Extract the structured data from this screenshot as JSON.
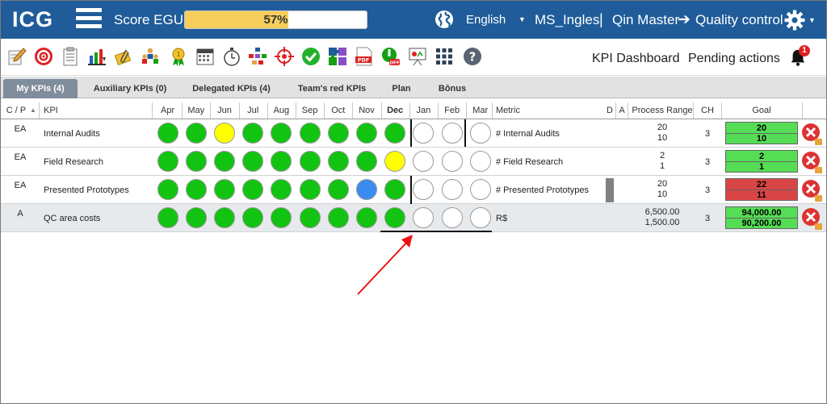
{
  "header": {
    "logo": "ICG",
    "score_label": "Score EGU:",
    "score_value": "57%",
    "score_fraction": 0.57,
    "language": "English",
    "user": "MS_Ingles",
    "separator": "|",
    "company": "Qin Master",
    "module": "Quality control",
    "colors": {
      "bar": "#1f5c99",
      "score_fill": "#f7ce5b"
    }
  },
  "toolbar": {
    "icons": [
      "pencil-icon",
      "target-icon",
      "clipboard-icon",
      "chart-down-icon",
      "paperclip-icon",
      "team-icon",
      "award-icon",
      "calendar-icon",
      "stopwatch-icon",
      "hierarchy-icon",
      "crosshair-icon",
      "check-circle-icon",
      "puzzle-icon",
      "pdf-icon",
      "power-off-icon",
      "presentation-icon",
      "grid-icon",
      "help-icon"
    ],
    "kpi_dashboard": "KPI Dashboard",
    "pending_actions": "Pending actions",
    "notification_count": "1"
  },
  "tabs": [
    {
      "label": "My KPIs (4)",
      "active": true
    },
    {
      "label": "Auxiliary KPIs (0)",
      "active": false
    },
    {
      "label": "Delegated KPIs (4)",
      "active": false
    },
    {
      "label": "Team's red KPIs",
      "active": false
    },
    {
      "label": "Plan",
      "active": false
    },
    {
      "label": "Bônus",
      "active": false
    }
  ],
  "columns": {
    "cp": "C / P",
    "sort_indicator": "▲",
    "kpi": "KPI",
    "months": [
      "Apr",
      "May",
      "Jun",
      "Jul",
      "Aug",
      "Sep",
      "Oct",
      "Nov",
      "Dec",
      "Jan",
      "Feb",
      "Mar"
    ],
    "current_month": "Dec",
    "metric": "Metric",
    "d": "D",
    "a": "A",
    "process_range": "Process Range",
    "ch": "CH",
    "goal": "Goal"
  },
  "status_colors": {
    "green": "#12c312",
    "yellow": "#ffff00",
    "blue": "#3a8cf0",
    "empty": "#ffffff",
    "goal_green": "#55dd55",
    "goal_red": "#d94545"
  },
  "rows": [
    {
      "cp": "EA",
      "kpi": "Internal Audits",
      "status": [
        "green",
        "green",
        "yellow",
        "green",
        "green",
        "green",
        "green",
        "green",
        "green",
        "empty",
        "empty",
        "empty"
      ],
      "metric": "# Internal Audits",
      "has_d": false,
      "range_top": "20",
      "range_bottom": "10",
      "ch": "3",
      "goal_top": "20",
      "goal_bottom": "10",
      "goal_color": "goal_green"
    },
    {
      "cp": "EA",
      "kpi": "Field Research",
      "status": [
        "green",
        "green",
        "green",
        "green",
        "green",
        "green",
        "green",
        "green",
        "yellow",
        "empty",
        "empty",
        "empty"
      ],
      "metric": "# Field Research",
      "has_d": false,
      "range_top": "2",
      "range_bottom": "1",
      "ch": "3",
      "goal_top": "2",
      "goal_bottom": "1",
      "goal_color": "goal_green"
    },
    {
      "cp": "EA",
      "kpi": "Presented Prototypes",
      "status": [
        "green",
        "green",
        "green",
        "green",
        "green",
        "green",
        "green",
        "blue",
        "green",
        "empty",
        "empty",
        "empty"
      ],
      "metric": "# Presented Prototypes",
      "has_d": true,
      "range_top": "20",
      "range_bottom": "10",
      "ch": "3",
      "goal_top": "22",
      "goal_bottom": "11",
      "goal_color": "goal_red"
    },
    {
      "cp": "A",
      "kpi": "QC area costs",
      "status": [
        "green",
        "green",
        "green",
        "green",
        "green",
        "green",
        "green",
        "green",
        "green",
        "empty",
        "empty",
        "empty"
      ],
      "metric": "R$",
      "has_d": false,
      "range_top": "6,500.00",
      "range_bottom": "1,500.00",
      "ch": "3",
      "goal_top": "94,000.00",
      "goal_bottom": "90,200.00",
      "goal_color": "goal_green",
      "highlighted": true
    }
  ]
}
